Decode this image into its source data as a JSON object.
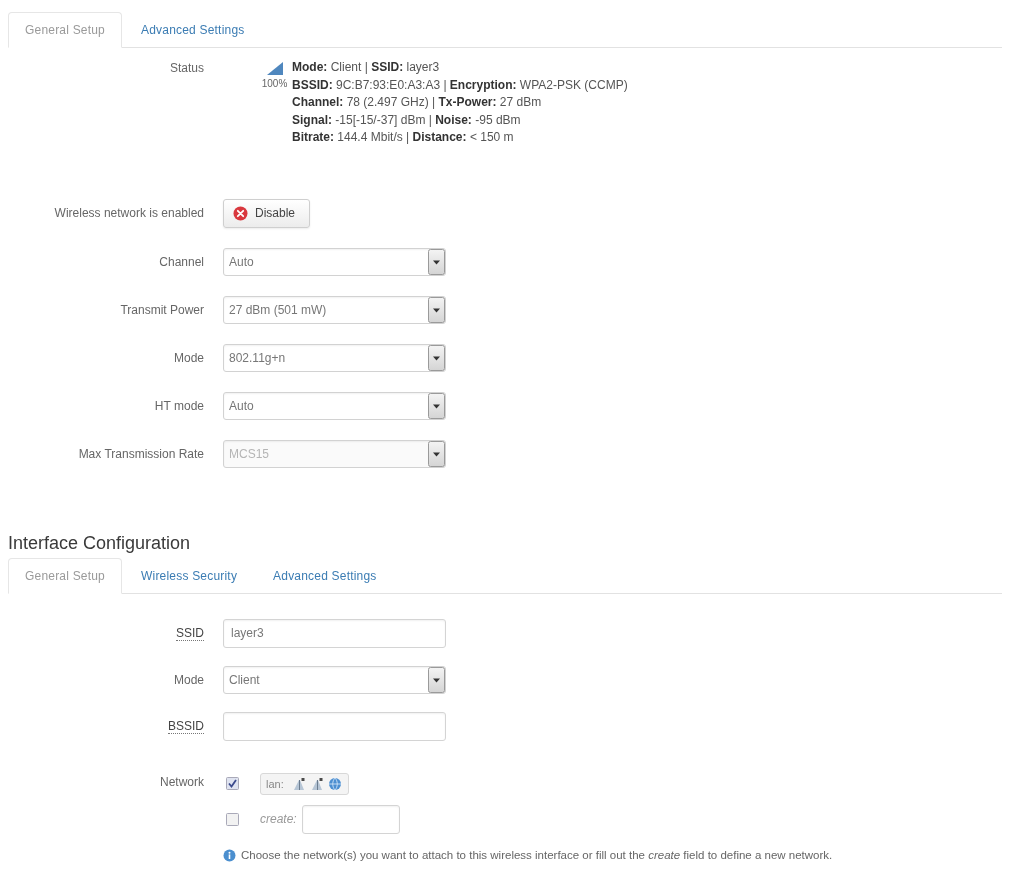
{
  "wireless_tabs": [
    {
      "label": "General Setup",
      "selected": true
    },
    {
      "label": "Advanced Settings",
      "selected": false
    }
  ],
  "status": {
    "label": "Status",
    "signal": "100%",
    "lines": [
      "**Mode:** Client | **SSID:** layer3",
      "**BSSID:** 9C:B7:93:E0:A3:A3 | **Encryption:** WPA2-PSK (CCMP)",
      "**Channel:** 78 (2.497 GHz) | **Tx-Power:** 27 dBm",
      "**Signal:** -15[-15/-37] dBm | **Noise:** -95 dBm",
      "**Bitrate:** 144.4 Mbit/s | **Distance:** < 150 m"
    ]
  },
  "device_fields": [
    {
      "kind": "button",
      "label": "Wireless network is enabled",
      "button": "Disable"
    },
    {
      "kind": "select",
      "label": "Channel",
      "value": "Auto",
      "disabled": false
    },
    {
      "kind": "select",
      "label": "Transmit Power",
      "value": "27 dBm (501 mW)",
      "disabled": false
    },
    {
      "kind": "select",
      "label": "Mode",
      "value": "802.11g+n",
      "disabled": false
    },
    {
      "kind": "select",
      "label": "HT mode",
      "value": "Auto",
      "disabled": false
    },
    {
      "kind": "select",
      "label": "Max Transmission Rate",
      "value": "MCS15",
      "disabled": true
    }
  ],
  "interface": {
    "title": "Interface Configuration",
    "tabs": [
      {
        "label": "General Setup",
        "selected": true
      },
      {
        "label": "Wireless Security",
        "selected": false
      },
      {
        "label": "Advanced Settings",
        "selected": false
      }
    ],
    "fields": [
      {
        "kind": "text",
        "label": "SSID",
        "has_help": true,
        "value": "layer3"
      },
      {
        "kind": "select",
        "label": "Mode",
        "has_help": false,
        "value": "Client"
      },
      {
        "kind": "text",
        "label": "BSSID",
        "has_help": true
      },
      {
        "kind": "network",
        "label": "Network",
        "has_help": false,
        "options": [
          {
            "kind": "existing",
            "checked": true,
            "name": "lan:"
          },
          {
            "kind": "create",
            "checked": false,
            "name": "create:"
          }
        ],
        "help": "Choose the network(s) you want to attach to this wireless interface or fill out the *create* field to define a new network."
      }
    ]
  }
}
